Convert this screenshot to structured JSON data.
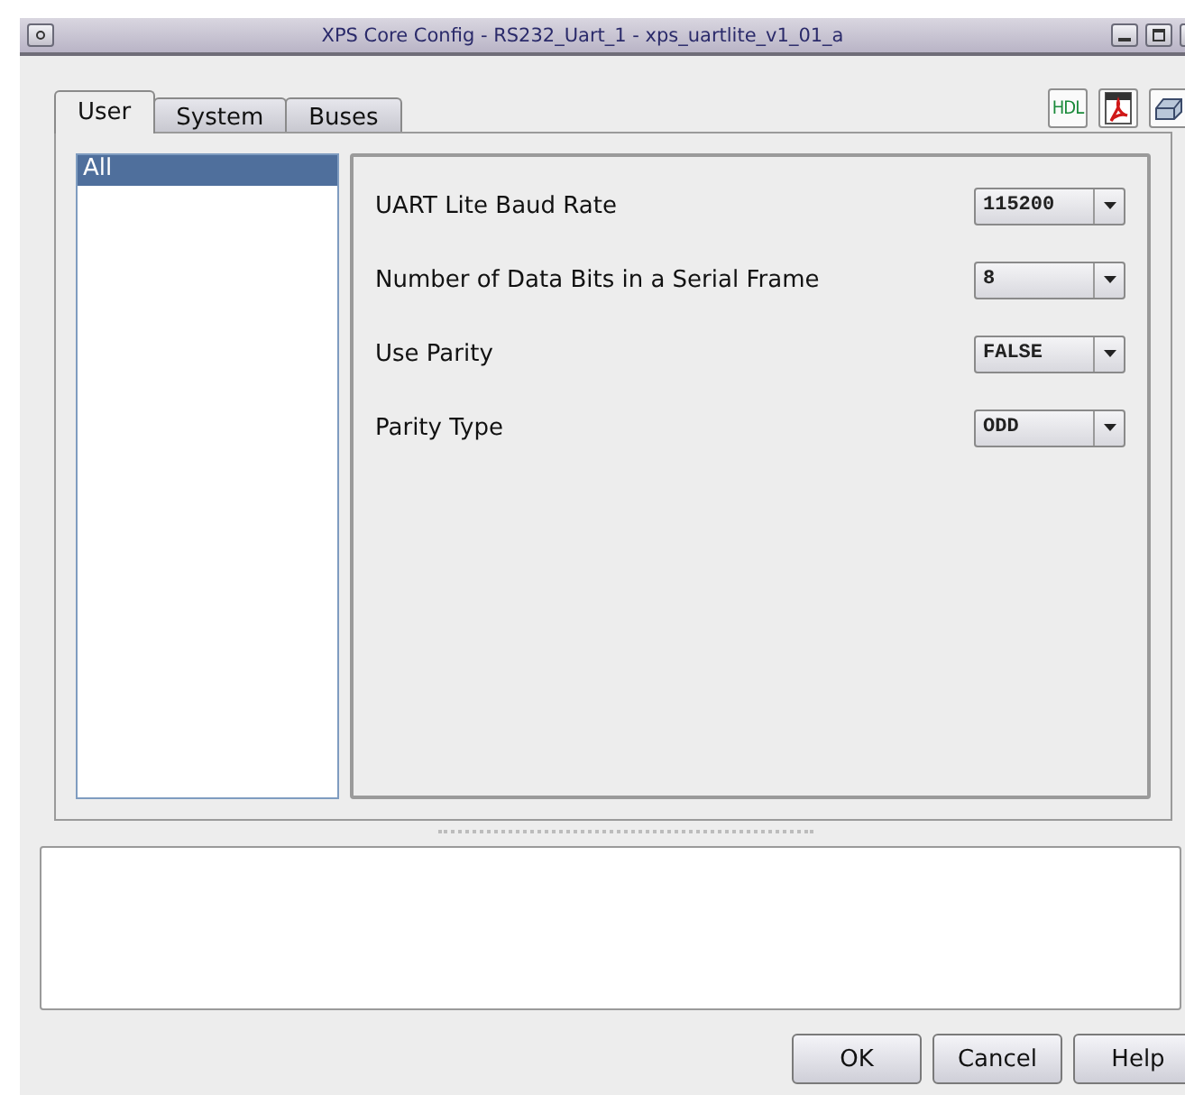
{
  "window": {
    "title": "XPS Core Config - RS232_Uart_1 - xps_uartlite_v1_01_a"
  },
  "tabs": [
    {
      "label": "User",
      "selected": true
    },
    {
      "label": "System",
      "selected": false
    },
    {
      "label": "Buses",
      "selected": false
    }
  ],
  "toolbar": {
    "hdl_label": "HDL"
  },
  "categories": [
    {
      "label": "All",
      "selected": true
    }
  ],
  "parameters": [
    {
      "label": "UART Lite Baud Rate",
      "value": "115200"
    },
    {
      "label": "Number of Data Bits in a Serial Frame",
      "value": "8"
    },
    {
      "label": "Use Parity",
      "value": "FALSE"
    },
    {
      "label": "Parity Type",
      "value": "ODD"
    }
  ],
  "buttons": [
    "OK",
    "Cancel",
    "Help"
  ]
}
